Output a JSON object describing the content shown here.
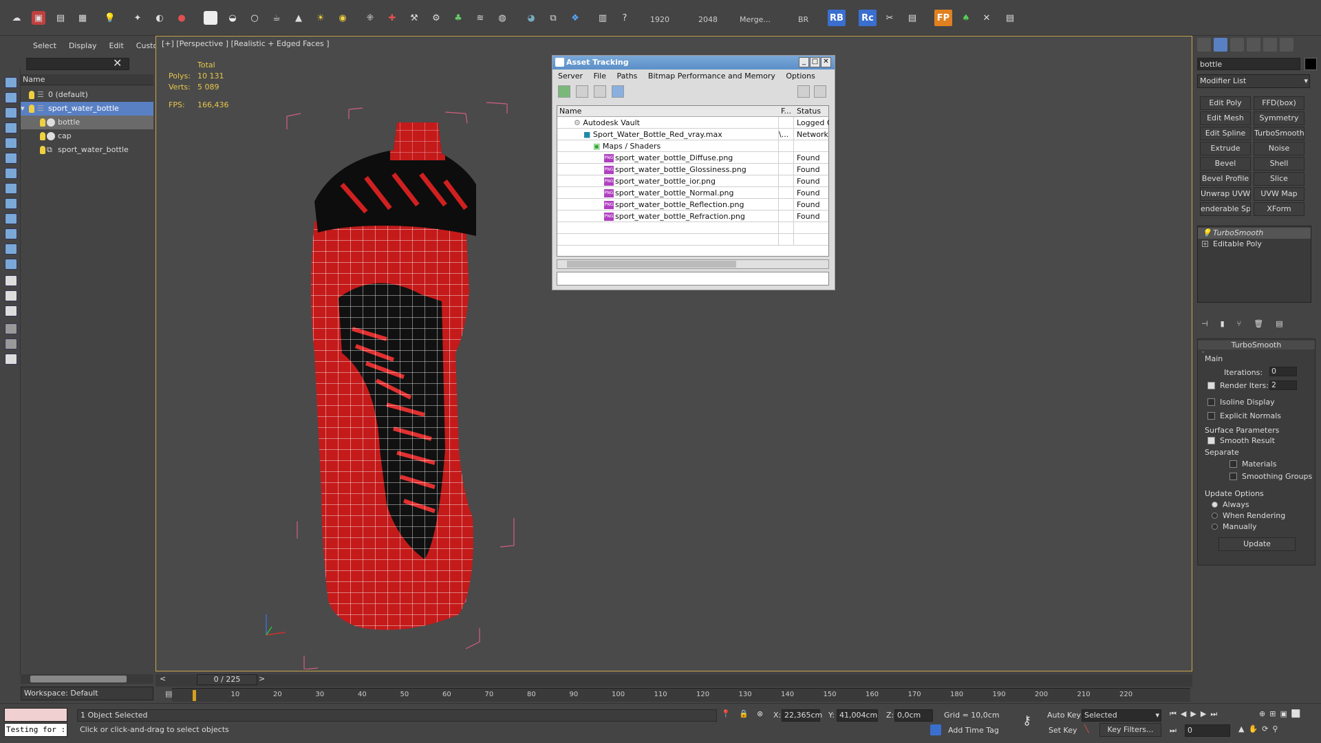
{
  "toolbar": {
    "values": [
      "1920",
      "2048",
      "Merge...",
      "BR"
    ],
    "rb_label": "RB",
    "rc_label": "Rc",
    "fp_label": "FP"
  },
  "explorer": {
    "menu": [
      "Select",
      "Display",
      "Edit",
      "Customize"
    ],
    "column_name": "Name",
    "rows": [
      {
        "label": "0 (default)"
      },
      {
        "label": "sport_water_bottle"
      },
      {
        "label": "bottle"
      },
      {
        "label": "cap"
      },
      {
        "label": "sport_water_bottle"
      }
    ],
    "workspace": "Workspace: Default"
  },
  "viewport": {
    "label": "[+] [Perspective ] [Realistic + Edged Faces ]",
    "stats_header": "Total",
    "polys_label": "Polys:",
    "polys": "10 131",
    "verts_label": "Verts:",
    "verts": "5 089",
    "fps_label": "FPS:",
    "fps": "166,436"
  },
  "asset": {
    "title": "Asset Tracking",
    "menu": [
      "Server",
      "File",
      "Paths",
      "Bitmap Performance and Memory",
      "Options"
    ],
    "headers": {
      "name": "Name",
      "f": "F...",
      "status": "Status"
    },
    "rows": [
      {
        "name": "Autodesk Vault",
        "f": "",
        "status": "Logged Ou"
      },
      {
        "name": "Sport_Water_Bottle_Red_vray.max",
        "f": "\\...",
        "status": "Network P"
      },
      {
        "name": "Maps / Shaders",
        "f": "",
        "status": ""
      },
      {
        "name": "sport_water_bottle_Diffuse.png",
        "f": "",
        "status": "Found"
      },
      {
        "name": "sport_water_bottle_Glossiness.png",
        "f": "",
        "status": "Found"
      },
      {
        "name": "sport_water_bottle_ior.png",
        "f": "",
        "status": "Found"
      },
      {
        "name": "sport_water_bottle_Normal.png",
        "f": "",
        "status": "Found"
      },
      {
        "name": "sport_water_bottle_Reflection.png",
        "f": "",
        "status": "Found"
      },
      {
        "name": "sport_water_bottle_Refraction.png",
        "f": "",
        "status": "Found"
      }
    ],
    "png_badge": "PNG"
  },
  "command": {
    "object_name": "bottle",
    "modifier_list": "Modifier List",
    "buttons": [
      "Edit Poly",
      "FFD(box)",
      "Edit Mesh",
      "Symmetry",
      "Edit Spline",
      "TurboSmooth",
      "Extrude",
      "Noise",
      "Bevel",
      "Shell",
      "Bevel Profile",
      "Slice",
      "Unwrap UVW",
      "UVW Map",
      "enderable Splin",
      "XForm"
    ],
    "stack": [
      "TurboSmooth",
      "Editable Poly"
    ],
    "rollout": {
      "title": "TurboSmooth",
      "main": "Main",
      "iterations_label": "Iterations:",
      "iterations": "0",
      "render_iters_label": "Render Iters:",
      "render_iters": "2",
      "isoline": "Isoline Display",
      "explicit": "Explicit Normals",
      "surface": "Surface Parameters",
      "smooth": "Smooth Result",
      "separate": "Separate",
      "materials": "Materials",
      "smoothing_groups": "Smoothing Groups",
      "update_options": "Update Options",
      "always": "Always",
      "when_rendering": "When Rendering",
      "manually": "Manually",
      "update": "Update"
    }
  },
  "timeline": {
    "slider": "0 / 225",
    "ticks": [
      "10",
      "20",
      "30",
      "40",
      "50",
      "60",
      "70",
      "80",
      "90",
      "100",
      "110",
      "120",
      "130",
      "140",
      "150",
      "160",
      "170",
      "180",
      "190",
      "200",
      "210",
      "220"
    ]
  },
  "status": {
    "script": "Testing for :",
    "selected": "1 Object Selected",
    "prompt": "Click or click-and-drag to select objects",
    "x_label": "X:",
    "x": "22,365cm",
    "y_label": "Y:",
    "y": "41,004cm",
    "z_label": "Z:",
    "z": "0,0cm",
    "grid": "Grid = 10,0cm",
    "add_time_tag": "Add Time Tag",
    "auto_key": "Auto Key",
    "set_key": "Set Key",
    "selected_dropdown": "Selected",
    "key_filters": "Key Filters...",
    "frame": "0"
  }
}
